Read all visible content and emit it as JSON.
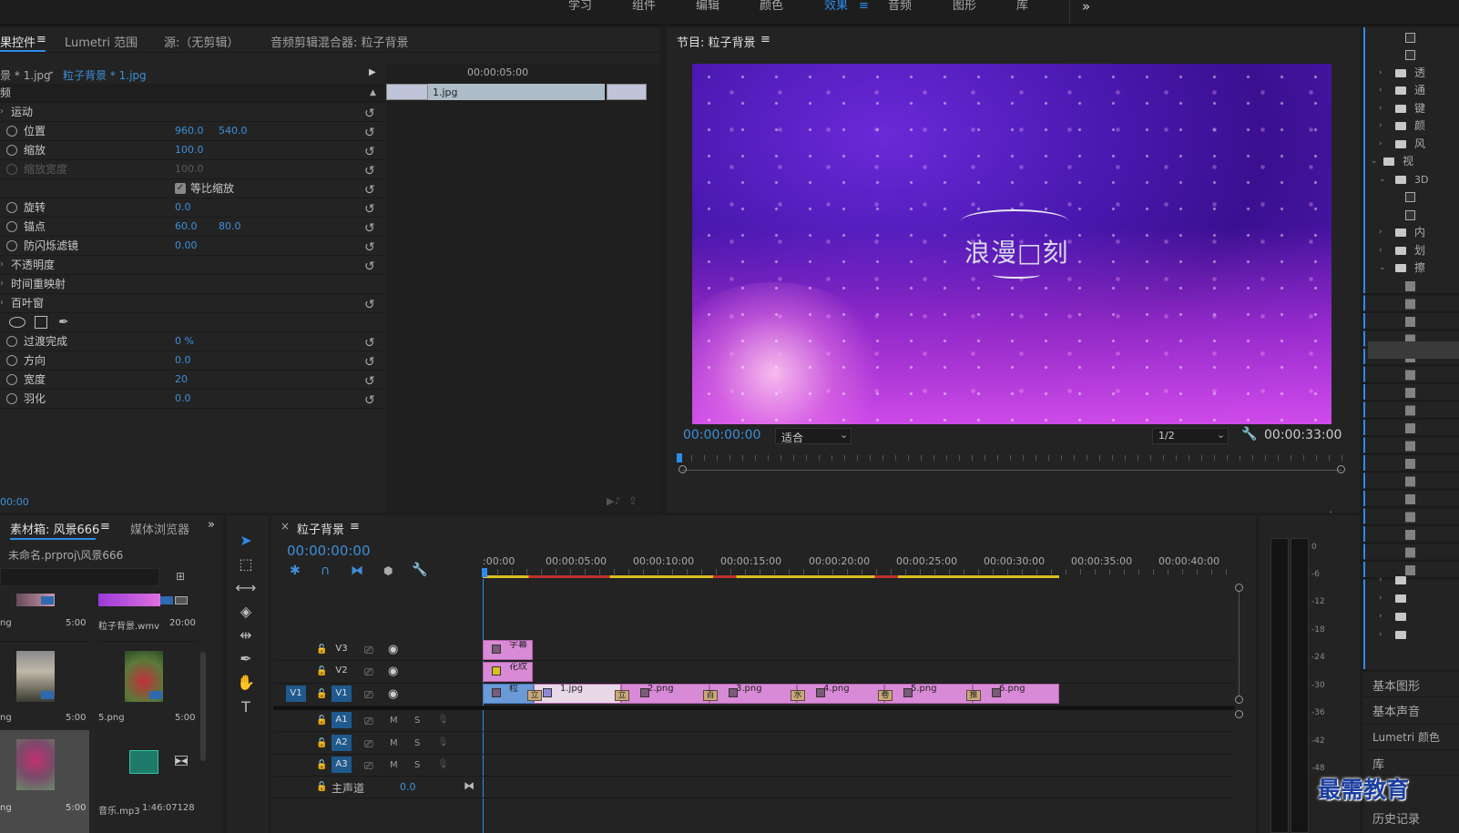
{
  "workspaces": {
    "items": [
      "学习",
      "组件",
      "编辑",
      "颜色",
      "效果",
      "音频",
      "图形",
      "库"
    ],
    "active": "效果",
    "more": "»"
  },
  "effect_controls": {
    "tabs": [
      "果控件",
      "Lumetri 范围",
      "源:（无剪辑）",
      "音频剪辑混合器: 粒子背景"
    ],
    "menu_icon": "≡",
    "source_clip": "景 * 1.jpg",
    "sequence_clip": "粒子背景 * 1.jpg",
    "header_fx": "频",
    "mini_timecode": "00:00:05:00",
    "mini_clip": "1.jpg",
    "motion": "运动",
    "props": [
      {
        "name": "位置",
        "v1": "960.0",
        "v2": "540.0"
      },
      {
        "name": "缩放",
        "v1": "100.0",
        "v2": ""
      },
      {
        "name": "缩放宽度",
        "v1": "100.0",
        "v2": ""
      },
      {
        "name": "旋转",
        "v1": "0.0",
        "v2": ""
      },
      {
        "name": "锚点",
        "v1": "60.0",
        "v2": "80.0"
      },
      {
        "name": "防闪烁滤镜",
        "v1": "0.00",
        "v2": ""
      }
    ],
    "uniform_scale": "等比缩放",
    "opacity": "不透明度",
    "time_remap": "时间重映射",
    "blinds": "百叶窗",
    "blind_props": [
      {
        "name": "过渡完成",
        "v1": "0 %"
      },
      {
        "name": "方向",
        "v1": "0.0"
      },
      {
        "name": "宽度",
        "v1": "20"
      },
      {
        "name": "羽化",
        "v1": "0.0"
      }
    ],
    "footer_timecode": "00:00"
  },
  "program_monitor": {
    "title": "节目: 粒子背景",
    "menu_icon": "≡",
    "overlay_title": "浪漫□刻",
    "current_time": "00:00:00:00",
    "fit": "适合",
    "resolution": "1/2",
    "duration": "00:00:33:00",
    "add_btn": "+"
  },
  "project_panel": {
    "tabs": [
      "素材箱: 风景666",
      "媒体浏览器"
    ],
    "path": "未命名.prproj\\风景666",
    "items": [
      {
        "name": "ng",
        "dur": "5:00"
      },
      {
        "name": "粒子背景.wmv",
        "dur": "20:00"
      },
      {
        "name": "ng",
        "dur": "5:00"
      },
      {
        "name": "5.png",
        "dur": "5:00"
      },
      {
        "name": "ng",
        "dur": "5:00"
      },
      {
        "name": "音乐.mp3",
        "dur": "1:46:07128"
      }
    ]
  },
  "timeline": {
    "close": "×",
    "title": "粒子背景",
    "timecode": "00:00:00:00",
    "ruler": [
      ":00:00",
      "00:00:05:00",
      "00:00:10:00",
      "00:00:15:00",
      "00:00:20:00",
      "00:00:25:00",
      "00:00:30:00",
      "00:00:35:00",
      "00:00:40:00"
    ],
    "tracks": {
      "v3": "V3",
      "v2": "V2",
      "v1": "V1",
      "a1": "A1",
      "a2": "A2",
      "a3": "A3",
      "mute": "M",
      "solo": "S",
      "master": "主声道",
      "master_val": "0.0"
    },
    "clips": {
      "v3": "字幕",
      "v2": "花纹",
      "v1": [
        "粒",
        "1.jpg",
        "2.png",
        "3.png",
        "4.png",
        "5.png",
        "6.png"
      ],
      "transitions": [
        "立",
        "立",
        "百",
        "水",
        "卷",
        "推"
      ]
    }
  },
  "meter_labels": [
    "0",
    "-6",
    "-12",
    "-18",
    "-24",
    "-30",
    "-36",
    "-42",
    "-48"
  ],
  "effects_panel": {
    "rows": [
      "透",
      "通",
      "键",
      "颜",
      "风",
      "视",
      "3D",
      "",
      "",
      "内",
      "划",
      "擦"
    ],
    "bottom": [
      "基本图形",
      "基本声音",
      "Lumetri 颜色",
      "库",
      "历史记录"
    ]
  },
  "watermark": "最需教育",
  "colors": {
    "accent": "#2d8ceb",
    "clip": "#d98ad6",
    "track_on": "#1f5a8e"
  }
}
